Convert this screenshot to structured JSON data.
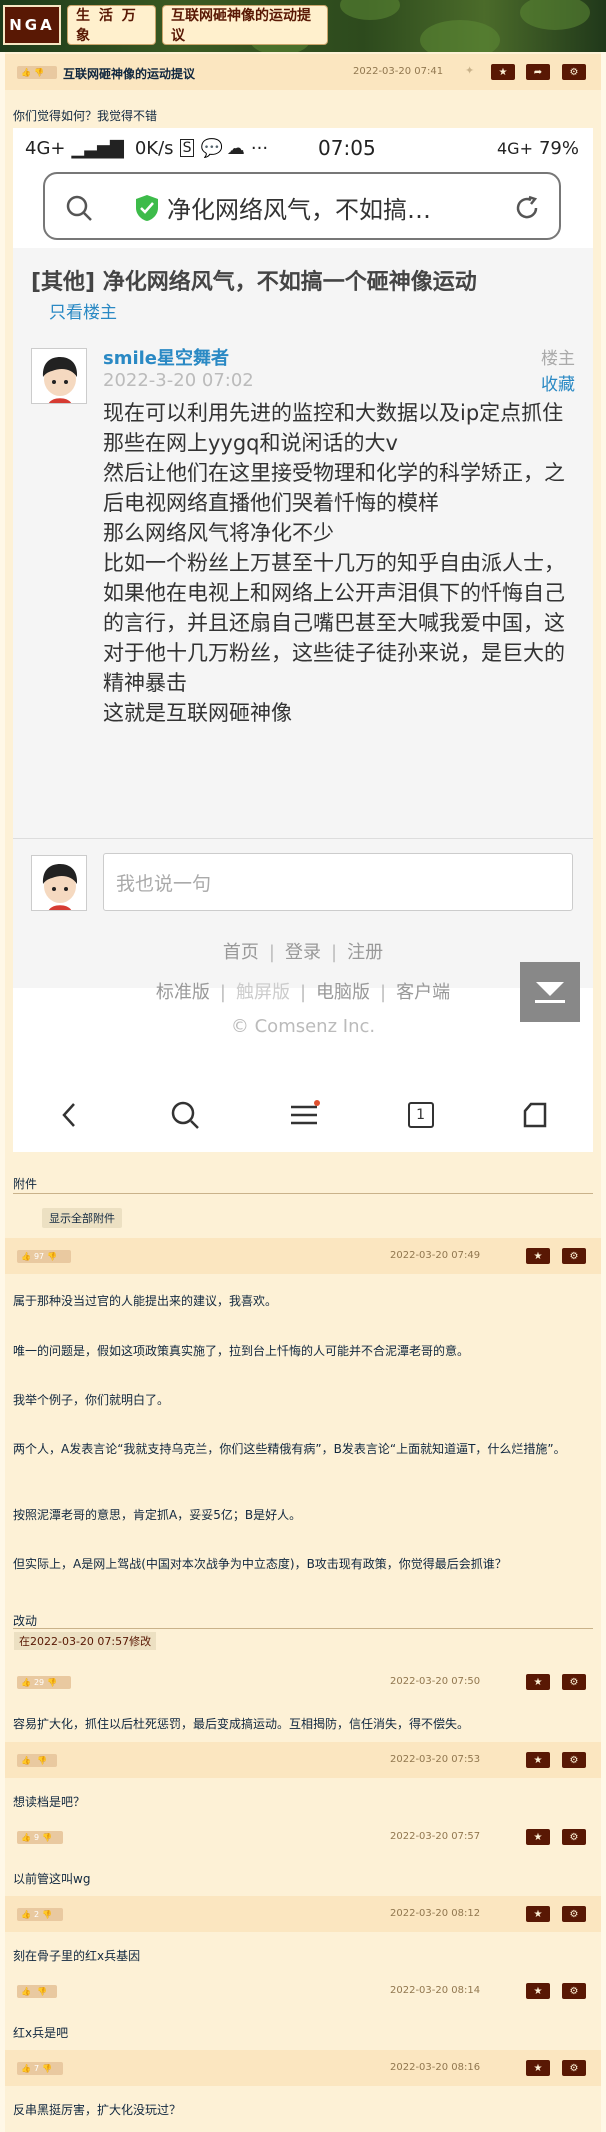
{
  "site": {
    "logo": "NGA",
    "crumb1": "生 活 万 象",
    "crumb2": "互联网砸神像的运动提议"
  },
  "main_post": {
    "rating": "",
    "title": "互联网砸神像的运动提议",
    "time": "2022-03-20 07:41",
    "intro": "你们觉得如何？我觉得不错"
  },
  "phone": {
    "status": {
      "net": "4G+",
      "speed": "0K/s",
      "time": "07:05",
      "net2": "4G+",
      "battery": "79%"
    },
    "url_text": "净化网络风气，不如搞…",
    "thread_title": "[其他] 净化网络风气，不如搞一个砸神像运动",
    "only_op": "只看楼主",
    "username": "smile星空舞者",
    "date": "2022-3-20 07:02",
    "floor": "楼主",
    "fav": "收藏",
    "body": [
      "现在可以利用先进的监控和大数据以及ip定点抓住那些在网上yygq和说闲话的大v",
      "然后让他们在这里接受物理和化学的科学矫正，之后电视网络直播他们哭着忏悔的模样",
      "那么网络风气将净化不少",
      "比如一个粉丝上万甚至十几万的知乎自由派人士，如果他在电视上和网络上公开声泪俱下的忏悔自己的言行，并且还扇自己嘴巴甚至大喊我爱中国，这对于他十几万粉丝，这些徒子徒孙来说，是巨大的精神暴击",
      "这就是互联网砸神像"
    ],
    "comment_placeholder": "我也说一句",
    "footer1": [
      "首页",
      "登录",
      "注册"
    ],
    "footer2": [
      "标准版",
      "触屏版",
      "电脑版",
      "客户端"
    ],
    "copyright": "© Comsenz Inc.",
    "tab_count": "1"
  },
  "attachments": {
    "label": "附件",
    "show_all": "显示全部附件"
  },
  "replies": [
    {
      "rating": "97",
      "time": "2022-03-20 07:49",
      "lines": [
        "属于那种没当过官的人能提出来的建议，我喜欢。",
        "唯一的问题是，假如这项政策真实施了，拉到台上忏悔的人可能并不合泥潭老哥的意。",
        "我举个例子，你们就明白了。",
        "两个人，A发表言论“我就支持乌克兰，你们这些精俄有病”，B发表言论“上面就知道逼T，什么烂措施”。",
        "按照泥潭老哥的意思，肯定抓A，妥妥5亿；B是好人。",
        "但实际上，A是网上驾战(中国对本次战争为中立态度)，B攻击现有政策，你觉得最后会抓谁？"
      ],
      "edit_label": "改动",
      "edited": "在2022-03-20 07:57修改"
    },
    {
      "rating": "29",
      "time": "2022-03-20 07:50",
      "lines": [
        "容易扩大化，抓住以后杜死惩罚，最后变成搞运动。互相揭防，信任消失，得不偿失。"
      ]
    },
    {
      "rating": "",
      "time": "2022-03-20 07:53",
      "lines": [
        "想读档是吧？"
      ]
    },
    {
      "rating": "9",
      "time": "2022-03-20 07:57",
      "lines": [
        "以前管这叫wg"
      ]
    },
    {
      "rating": "2",
      "time": "2022-03-20 08:12",
      "lines": [
        "刻在骨子里的红x兵基因"
      ]
    },
    {
      "rating": "",
      "time": "2022-03-20 08:14",
      "lines": [
        "红x兵是吧"
      ]
    },
    {
      "rating": "7",
      "time": "2022-03-20 08:16",
      "lines": [
        "反串黑挺厉害，扩大化没玩过？"
      ]
    }
  ]
}
